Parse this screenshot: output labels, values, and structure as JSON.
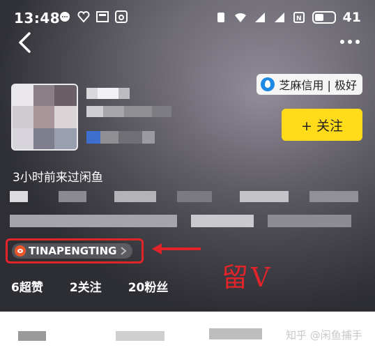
{
  "status_bar": {
    "time": "13:48",
    "battery": "41"
  },
  "credit_badge": {
    "text": "芝麻信用 | 极好"
  },
  "follow_button": {
    "label": "+ 关注"
  },
  "last_seen": "3小时前来过闲鱼",
  "weibo_tag": {
    "label": "TINAPENGTING"
  },
  "annotation": {
    "handwritten": "留V"
  },
  "stats": [
    {
      "label": "6超赞"
    },
    {
      "label": "2关注"
    },
    {
      "label": "20粉丝"
    }
  ],
  "watermark": "知乎 @闲鱼捕手",
  "colors": {
    "accent_yellow": "#ffdb1a",
    "annotation_red": "#e0242a"
  }
}
